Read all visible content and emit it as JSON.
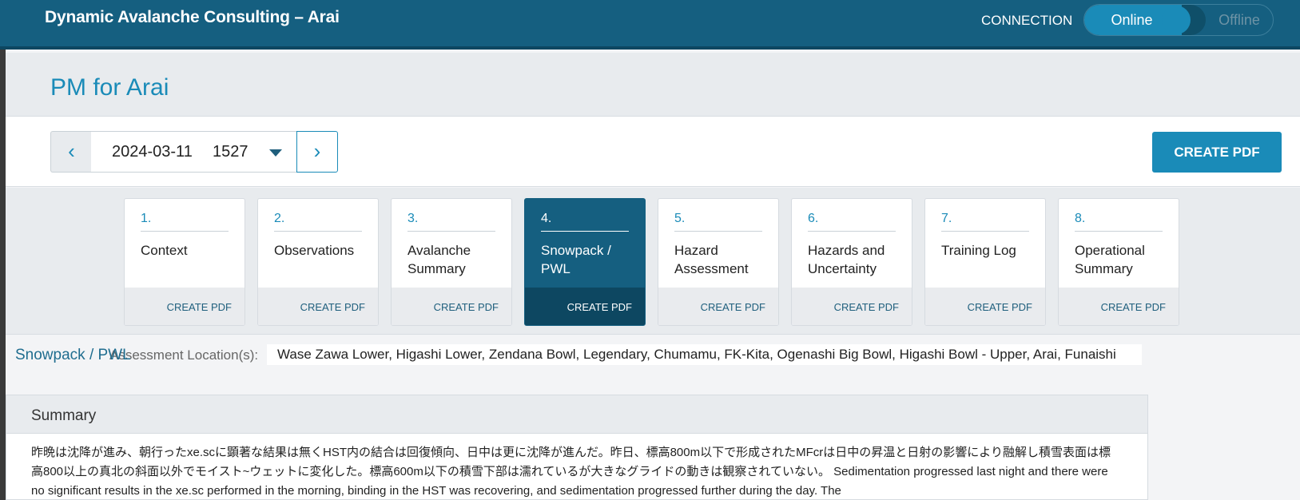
{
  "app": {
    "title": "Dynamic Avalanche Consulting – Arai",
    "connection_label": "CONNECTION",
    "toggle": {
      "on_label": "Online",
      "off_label": "Offline",
      "state": "Online"
    }
  },
  "page": {
    "title": "PM for Arai"
  },
  "nav": {
    "prev_icon": "‹",
    "next_icon": "›",
    "date": "2024-03-11",
    "time": "1527",
    "create_pdf_label": "CREATE PDF"
  },
  "steps": [
    {
      "number": "1.",
      "label": "Context",
      "pdf": "CREATE PDF"
    },
    {
      "number": "2.",
      "label": "Observations",
      "pdf": "CREATE PDF"
    },
    {
      "number": "3.",
      "label": "Avalanche Summary",
      "pdf": "CREATE PDF"
    },
    {
      "number": "4.",
      "label": "Snowpack / PWL",
      "pdf": "CREATE PDF"
    },
    {
      "number": "5.",
      "label": "Hazard Assessment",
      "pdf": "CREATE PDF"
    },
    {
      "number": "6.",
      "label": "Hazards and Uncertainty",
      "pdf": "CREATE PDF"
    },
    {
      "number": "7.",
      "label": "Training Log",
      "pdf": "CREATE PDF"
    },
    {
      "number": "8.",
      "label": "Operational Summary",
      "pdf": "CREATE PDF"
    }
  ],
  "active_step": 4,
  "section": {
    "title": "Snowpack / PWL",
    "assessment_label": "Assessment Location(s):",
    "assessment_locations": "Wase Zawa Lower, Higashi Lower, Zendana Bowl, Legendary, Chumamu, FK-Kita, Ogenashi Big Bowl, Higashi Bowl - Upper, Arai, Funaishi"
  },
  "summary": {
    "heading": "Summary",
    "text": "昨晩は沈降が進み、朝行ったxe.scに顕著な結果は無くHST内の結合は回復傾向、日中は更に沈降が進んだ。昨日、標高800m以下で形成されたMFcrは日中の昇温と日射の影響により融解し積雪表面は標高800以上の真北の斜面以外でモイスト~ウェットに変化した。標高600m以下の積雪下部は濡れているが大きなグライドの動きは観察されていない。 Sedimentation progressed last night and there were no significant results in the xe.sc performed in the morning, binding in the HST was recovering, and sedimentation progressed further during the day. The"
  },
  "colors": {
    "brand": "#155f80",
    "accent": "#1a8bb8",
    "active_step_bg": "#155f80"
  }
}
